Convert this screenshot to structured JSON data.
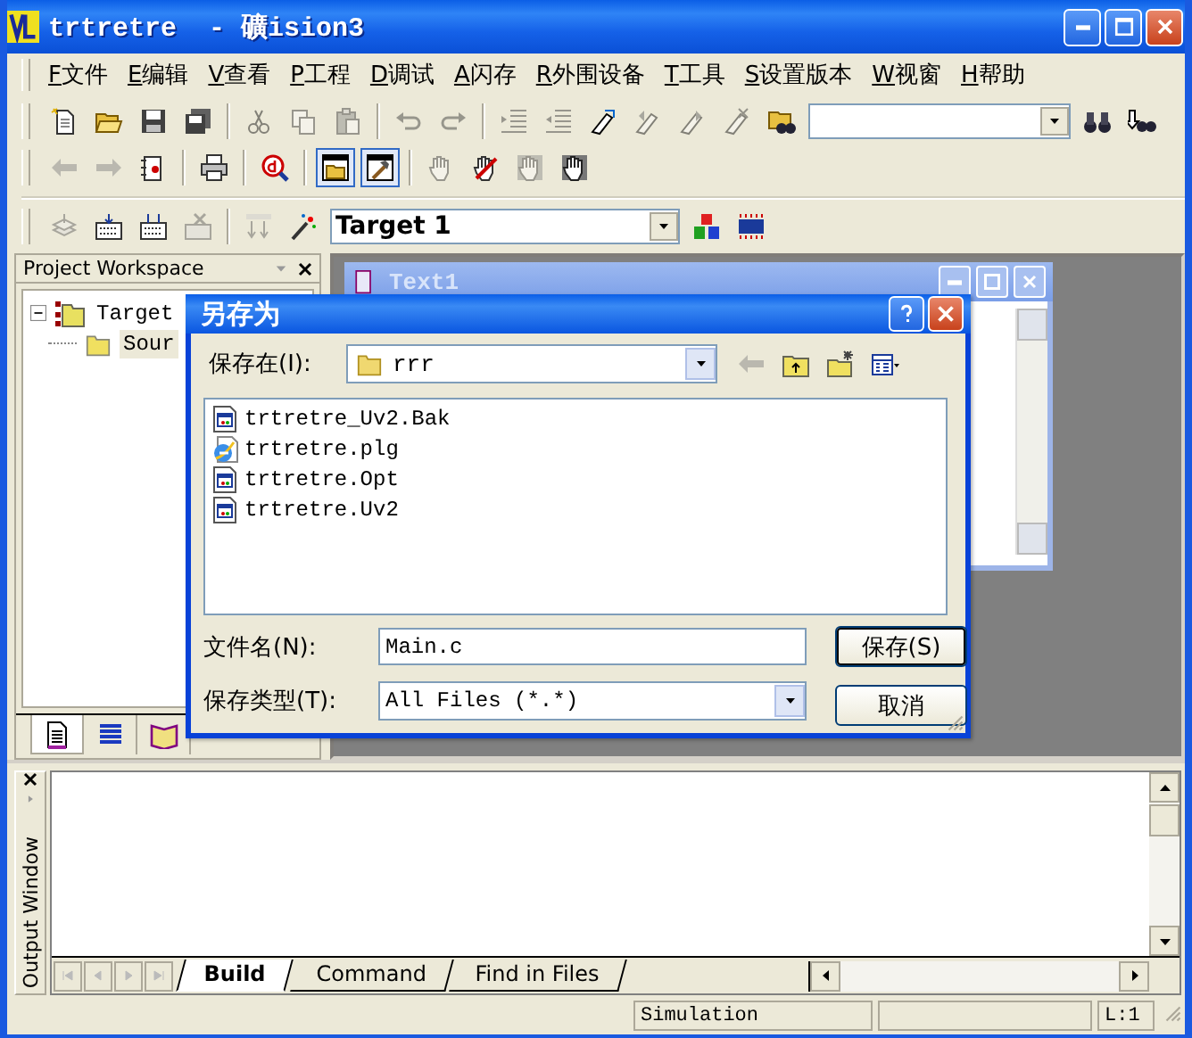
{
  "window": {
    "title": "trtretre  - 礦ision3"
  },
  "menu": [
    "F文件",
    "E编辑",
    "V查看",
    "P工程",
    "D调试",
    "A闪存",
    "R外围设备",
    "T工具",
    "S设置版本",
    "W视窗",
    "H帮助"
  ],
  "toolbars": [
    [
      {
        "kind": "new",
        "disabled": false,
        "pressed": false
      },
      {
        "kind": "open",
        "disabled": false,
        "pressed": false
      },
      {
        "kind": "save",
        "disabled": false,
        "pressed": false
      },
      {
        "kind": "saveall",
        "disabled": false,
        "pressed": false
      },
      {
        "kind": "sep"
      },
      {
        "kind": "cut",
        "disabled": true,
        "pressed": false
      },
      {
        "kind": "copy",
        "disabled": true,
        "pressed": false
      },
      {
        "kind": "paste",
        "disabled": true,
        "pressed": false
      },
      {
        "kind": "sep"
      },
      {
        "kind": "undo",
        "disabled": true,
        "pressed": false
      },
      {
        "kind": "redo",
        "disabled": true,
        "pressed": false
      },
      {
        "kind": "sep"
      },
      {
        "kind": "indent",
        "disabled": true,
        "pressed": false
      },
      {
        "kind": "outdent",
        "disabled": true,
        "pressed": false
      },
      {
        "kind": "bookmark",
        "disabled": false,
        "pressed": false
      },
      {
        "kind": "bmprev",
        "disabled": true,
        "pressed": false
      },
      {
        "kind": "bmnext",
        "disabled": true,
        "pressed": false
      },
      {
        "kind": "bmclear",
        "disabled": true,
        "pressed": false
      },
      {
        "kind": "findfiles",
        "disabled": false,
        "pressed": false
      },
      {
        "kind": "combo"
      },
      {
        "kind": "find",
        "disabled": false,
        "pressed": false
      },
      {
        "kind": "findnext",
        "disabled": false,
        "pressed": false
      }
    ],
    [
      {
        "kind": "back",
        "disabled": true,
        "pressed": false
      },
      {
        "kind": "forward",
        "disabled": true,
        "pressed": false
      },
      {
        "kind": "goto",
        "disabled": false,
        "pressed": false
      },
      {
        "kind": "sep"
      },
      {
        "kind": "print",
        "disabled": false,
        "pressed": false
      },
      {
        "kind": "sep"
      },
      {
        "kind": "debug",
        "disabled": false,
        "pressed": false
      },
      {
        "kind": "sep"
      },
      {
        "kind": "workspace",
        "disabled": false,
        "pressed": true
      },
      {
        "kind": "output",
        "disabled": false,
        "pressed": true
      },
      {
        "kind": "sep"
      },
      {
        "kind": "hand",
        "disabled": true,
        "pressed": false
      },
      {
        "kind": "handx",
        "disabled": false,
        "pressed": false
      },
      {
        "kind": "handoff",
        "disabled": true,
        "pressed": false
      },
      {
        "kind": "handall",
        "disabled": false,
        "pressed": false
      }
    ],
    [
      {
        "kind": "stack",
        "disabled": true,
        "pressed": false
      },
      {
        "kind": "build",
        "disabled": false,
        "pressed": false
      },
      {
        "kind": "rebuild",
        "disabled": false,
        "pressed": false
      },
      {
        "kind": "stop",
        "disabled": true,
        "pressed": false
      },
      {
        "kind": "sep"
      },
      {
        "kind": "load",
        "disabled": true,
        "pressed": false
      },
      {
        "kind": "wand",
        "disabled": false,
        "pressed": false
      },
      {
        "kind": "combo",
        "value": "Target 1"
      },
      {
        "kind": "blocks",
        "disabled": false,
        "pressed": false
      },
      {
        "kind": "chip",
        "disabled": false,
        "pressed": false
      }
    ]
  ],
  "workspace": {
    "title": "Project Workspace",
    "tree": [
      {
        "label": "Target",
        "expanded": true,
        "selected": false,
        "children": [
          {
            "label": "Sour",
            "selected": true
          }
        ]
      }
    ],
    "tabs": [
      {
        "kind": "files",
        "selected": true
      },
      {
        "kind": "registers",
        "selected": false
      },
      {
        "kind": "books",
        "selected": false
      }
    ]
  },
  "editor_window": {
    "title": "Text1"
  },
  "dialog": {
    "title": "另存为",
    "save_in_label": "保存在(I):",
    "save_in": "rrr",
    "nav": [
      {
        "kind": "back",
        "disabled": true
      },
      {
        "kind": "up",
        "disabled": false
      },
      {
        "kind": "newfolder",
        "disabled": false
      },
      {
        "kind": "views",
        "disabled": false
      }
    ],
    "files": [
      {
        "name": "trtretre_Uv2.Bak",
        "kind": "project"
      },
      {
        "name": "trtretre.plg",
        "kind": "web"
      },
      {
        "name": "trtretre.Opt",
        "kind": "project"
      },
      {
        "name": "trtretre.Uv2",
        "kind": "project"
      }
    ],
    "filename_label": "文件名(N):",
    "filename": "Main.c",
    "filetype_label": "保存类型(T):",
    "filetype": "All Files (*.*)",
    "buttons": [
      {
        "label": "保存(S)",
        "default": true
      },
      {
        "label": "取消",
        "default": false
      }
    ]
  },
  "output": {
    "title": "Output Window",
    "tabs": [
      {
        "label": "Build",
        "selected": true
      },
      {
        "label": "Command",
        "selected": false
      },
      {
        "label": "Find in Files",
        "selected": false
      }
    ]
  },
  "status_bar": {
    "mode": "Simulation",
    "position": "L:1"
  }
}
